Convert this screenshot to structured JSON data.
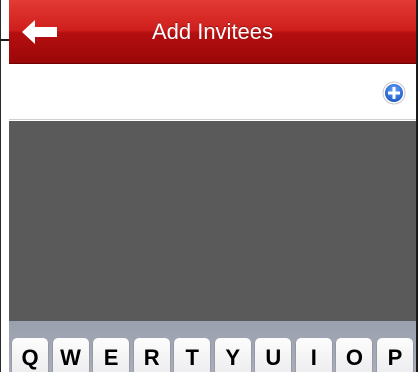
{
  "navbar": {
    "title": "Add Invitees",
    "back_icon": "back-arrow-icon"
  },
  "invitees": {
    "add_icon": "plus-circle-icon"
  },
  "keyboard": {
    "row1": [
      "Q",
      "W",
      "E",
      "R",
      "T",
      "Y",
      "U",
      "I",
      "O",
      "P"
    ]
  },
  "colors": {
    "navbar_red": "#cf1f1d",
    "add_blue": "#2e6fd6",
    "dim_overlay": "#5a5a5a"
  }
}
